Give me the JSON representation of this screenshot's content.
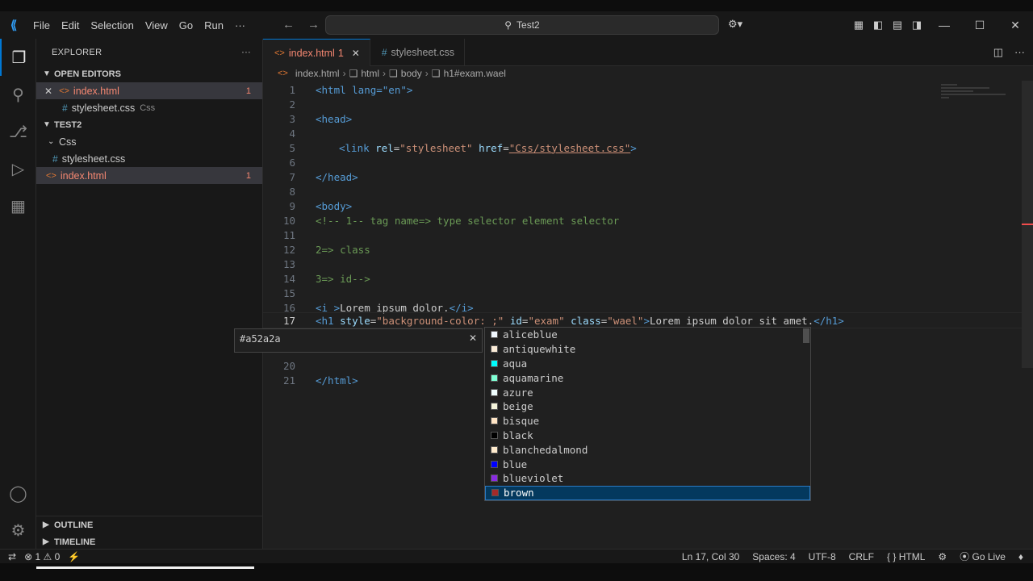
{
  "menu": [
    "File",
    "Edit",
    "Selection",
    "View",
    "Go",
    "Run",
    "···"
  ],
  "search": {
    "label": "Test2"
  },
  "sidebar": {
    "title": "EXPLORER",
    "open_editors_label": "OPEN EDITORS",
    "open_editors": [
      {
        "name": "index.html",
        "badge": "1"
      },
      {
        "name": "stylesheet.css",
        "folder": "Css"
      }
    ],
    "project_label": "TEST2",
    "tree": {
      "folder": "Css",
      "css_file": "stylesheet.css",
      "html_file": "index.html",
      "html_badge": "1"
    },
    "outline_label": "OUTLINE",
    "timeline_label": "TIMELINE"
  },
  "tabs": [
    {
      "label": "index.html",
      "badge": "1"
    },
    {
      "label": "stylesheet.css"
    }
  ],
  "breadcrumb": [
    "index.html",
    "html",
    "body",
    "h1#exam.wael"
  ],
  "editor": {
    "line_numbers": [
      "1",
      "2",
      "3",
      "4",
      "5",
      "6",
      "7",
      "8",
      "9",
      "10",
      "11",
      "12",
      "13",
      "14",
      "15",
      "16",
      "17",
      "20",
      "21"
    ],
    "lines": {
      "l1": "<html lang=\"en\">",
      "l3": "<head>",
      "l5a": "<link ",
      "l5b": "rel",
      "l5c": "=",
      "l5d": "\"stylesheet\"",
      "l5e": " href",
      "l5f": "=",
      "l5g": "\"Css/stylesheet.css\"",
      "l5h": ">",
      "l7": "</head>",
      "l9": "<body>",
      "l10": "<!-- 1-- tag name=> type selector element selector",
      "l12": "2=> class",
      "l14": "3=> id-->",
      "l16a": "<i >",
      "l16b": "Lorem ipsum dolor.",
      "l16c": "</i>",
      "l17a": "<h1 ",
      "l17b": "style",
      "l17c": "=",
      "l17d": "\"background-color: ",
      "l17e": ";\"",
      "l17f": " id",
      "l17g": "\"exam\"",
      "l17h": " class",
      "l17i": "\"wael\"",
      "l17j": "Lorem ipsum dolor sit amet.",
      "l17k": "</h1>",
      "l21": "</html>"
    }
  },
  "hover": {
    "value": "#a52a2a"
  },
  "suggestions": [
    {
      "label": "aliceblue",
      "color": "#f0f8ff"
    },
    {
      "label": "antiquewhite",
      "color": "#faebd7"
    },
    {
      "label": "aqua",
      "color": "#00ffff"
    },
    {
      "label": "aquamarine",
      "color": "#7fffd4"
    },
    {
      "label": "azure",
      "color": "#f0ffff"
    },
    {
      "label": "beige",
      "color": "#f5f5dc"
    },
    {
      "label": "bisque",
      "color": "#ffe4c4"
    },
    {
      "label": "black",
      "color": "#000000"
    },
    {
      "label": "blanchedalmond",
      "color": "#ffebcd"
    },
    {
      "label": "blue",
      "color": "#0000ff"
    },
    {
      "label": "blueviolet",
      "color": "#8a2be2"
    },
    {
      "label": "brown",
      "color": "#a52a2a"
    }
  ],
  "status": {
    "errors": "1",
    "warnings": "0",
    "position": "Ln 17, Col 30",
    "spaces": "Spaces: 4",
    "encoding": "UTF-8",
    "eol": "CRLF",
    "language": "HTML",
    "golive": "Go Live"
  }
}
